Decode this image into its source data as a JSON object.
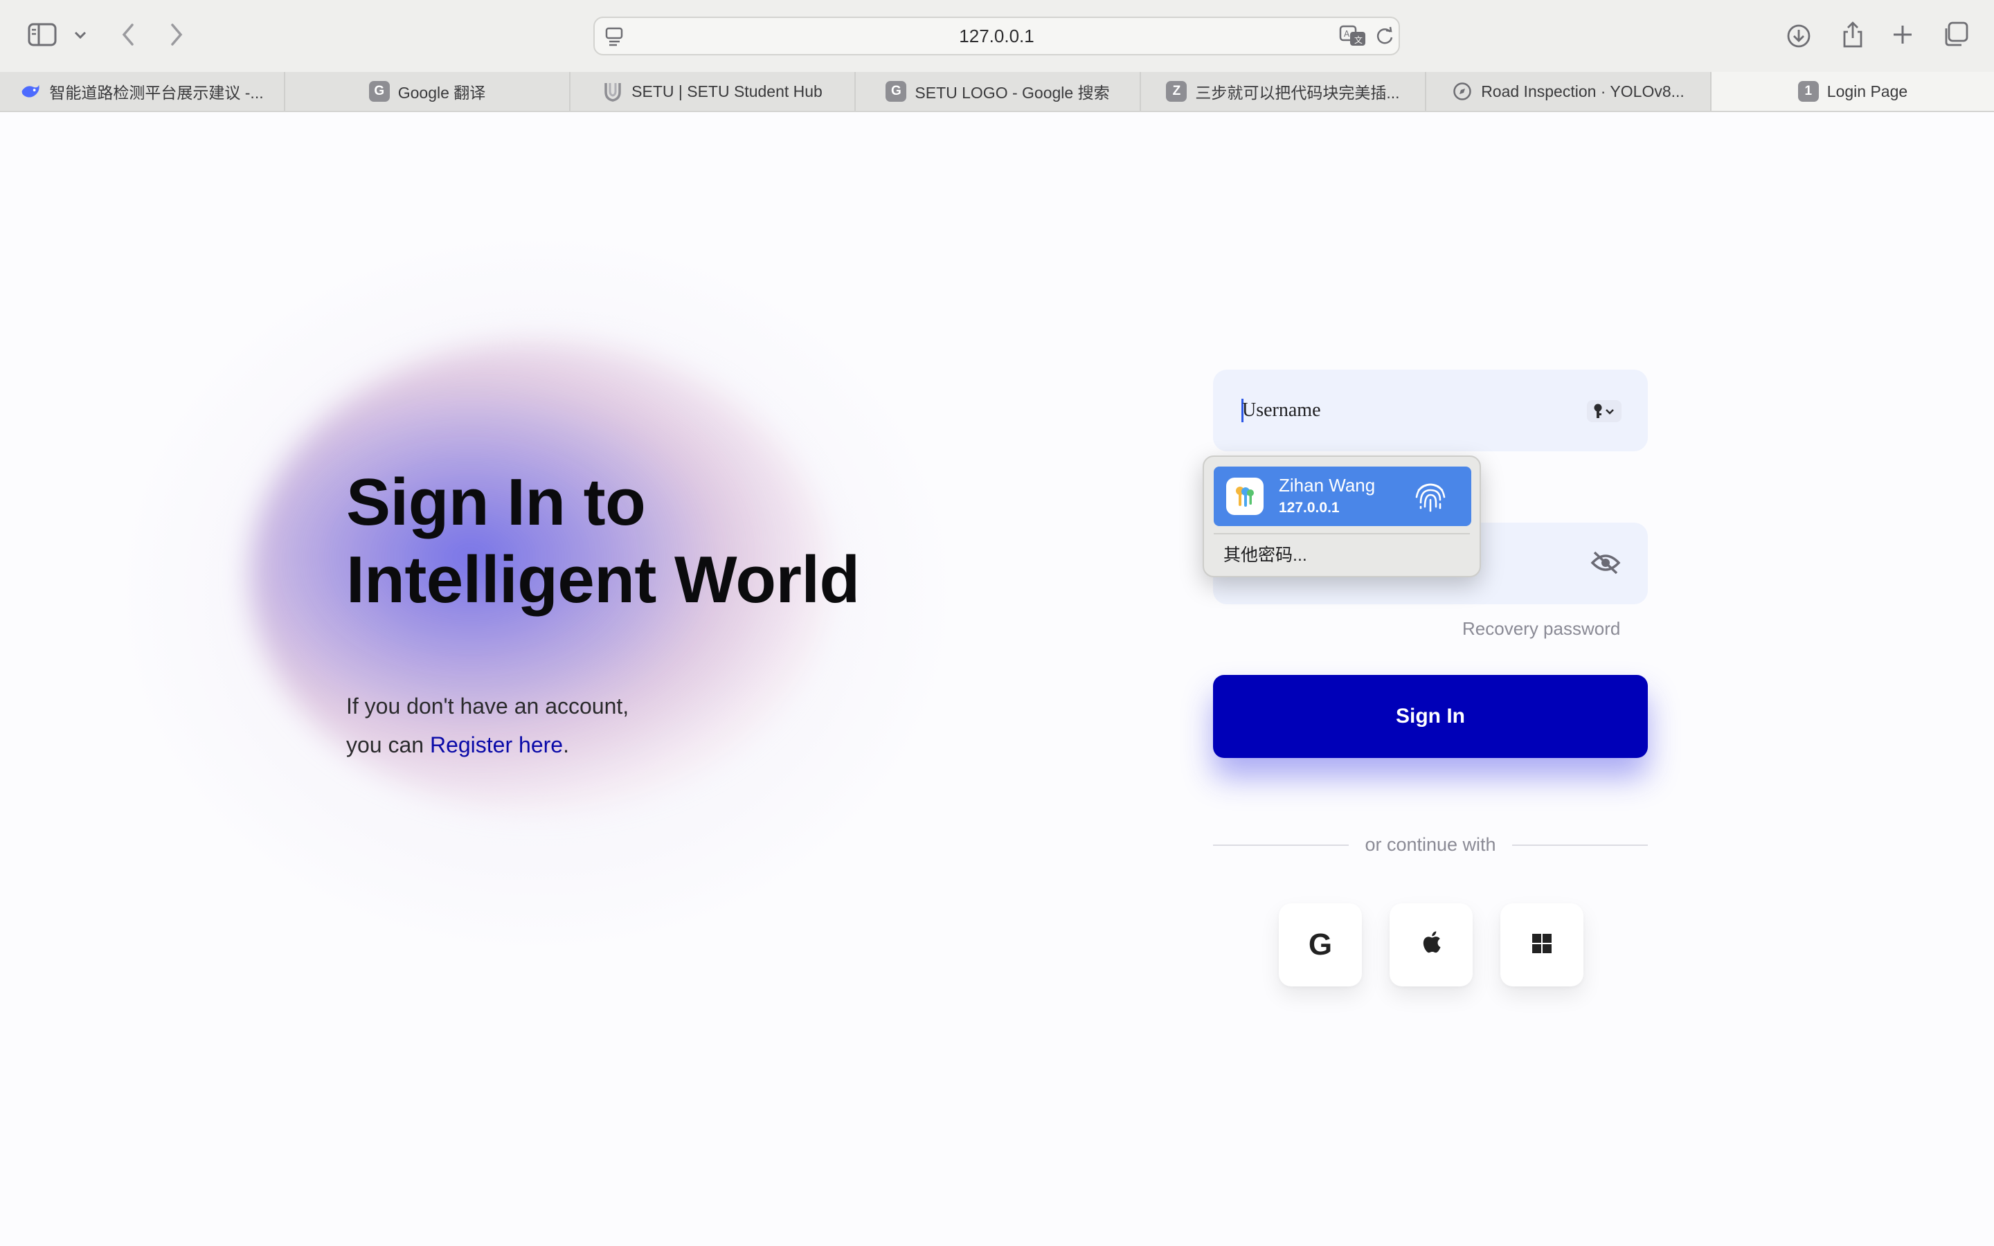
{
  "browser": {
    "url": "127.0.0.1",
    "tabs": [
      {
        "label": "智能道路检测平台展示建议 -...",
        "favicon": "deepseek-whale-icon"
      },
      {
        "label": "Google 翻译",
        "favicon": "G"
      },
      {
        "label": "SETU | SETU Student Hub",
        "favicon": "setu-shield-icon"
      },
      {
        "label": "SETU LOGO - Google 搜索",
        "favicon": "G"
      },
      {
        "label": "三步就可以把代码块完美插...",
        "favicon": "Z"
      },
      {
        "label": "Road Inspection · YOLOv8...",
        "favicon": "compass-icon"
      },
      {
        "label": "Login Page",
        "favicon": "1",
        "active": true
      }
    ]
  },
  "page": {
    "headline": [
      "Sign In to",
      "Intelligent World"
    ],
    "subtext_line1": "If you don't have an account,",
    "subtext_line2_prefix": "you can ",
    "register_link": "Register here",
    "subtext_suffix": ".",
    "username_value": "Username",
    "recovery_link": "Recovery password",
    "signin_label": "Sign In",
    "divider_text": "or continue with",
    "social": [
      {
        "name": "google",
        "glyph": "G"
      },
      {
        "name": "apple",
        "icon": "apple-icon"
      },
      {
        "name": "windows",
        "icon": "windows-icon"
      }
    ],
    "accent_color": "#0000b8",
    "field_bg": "#eef2fd"
  },
  "password_popup": {
    "credential_name": "Zihan Wang",
    "credential_host": "127.0.0.1",
    "other_passwords": "其他密码..."
  }
}
